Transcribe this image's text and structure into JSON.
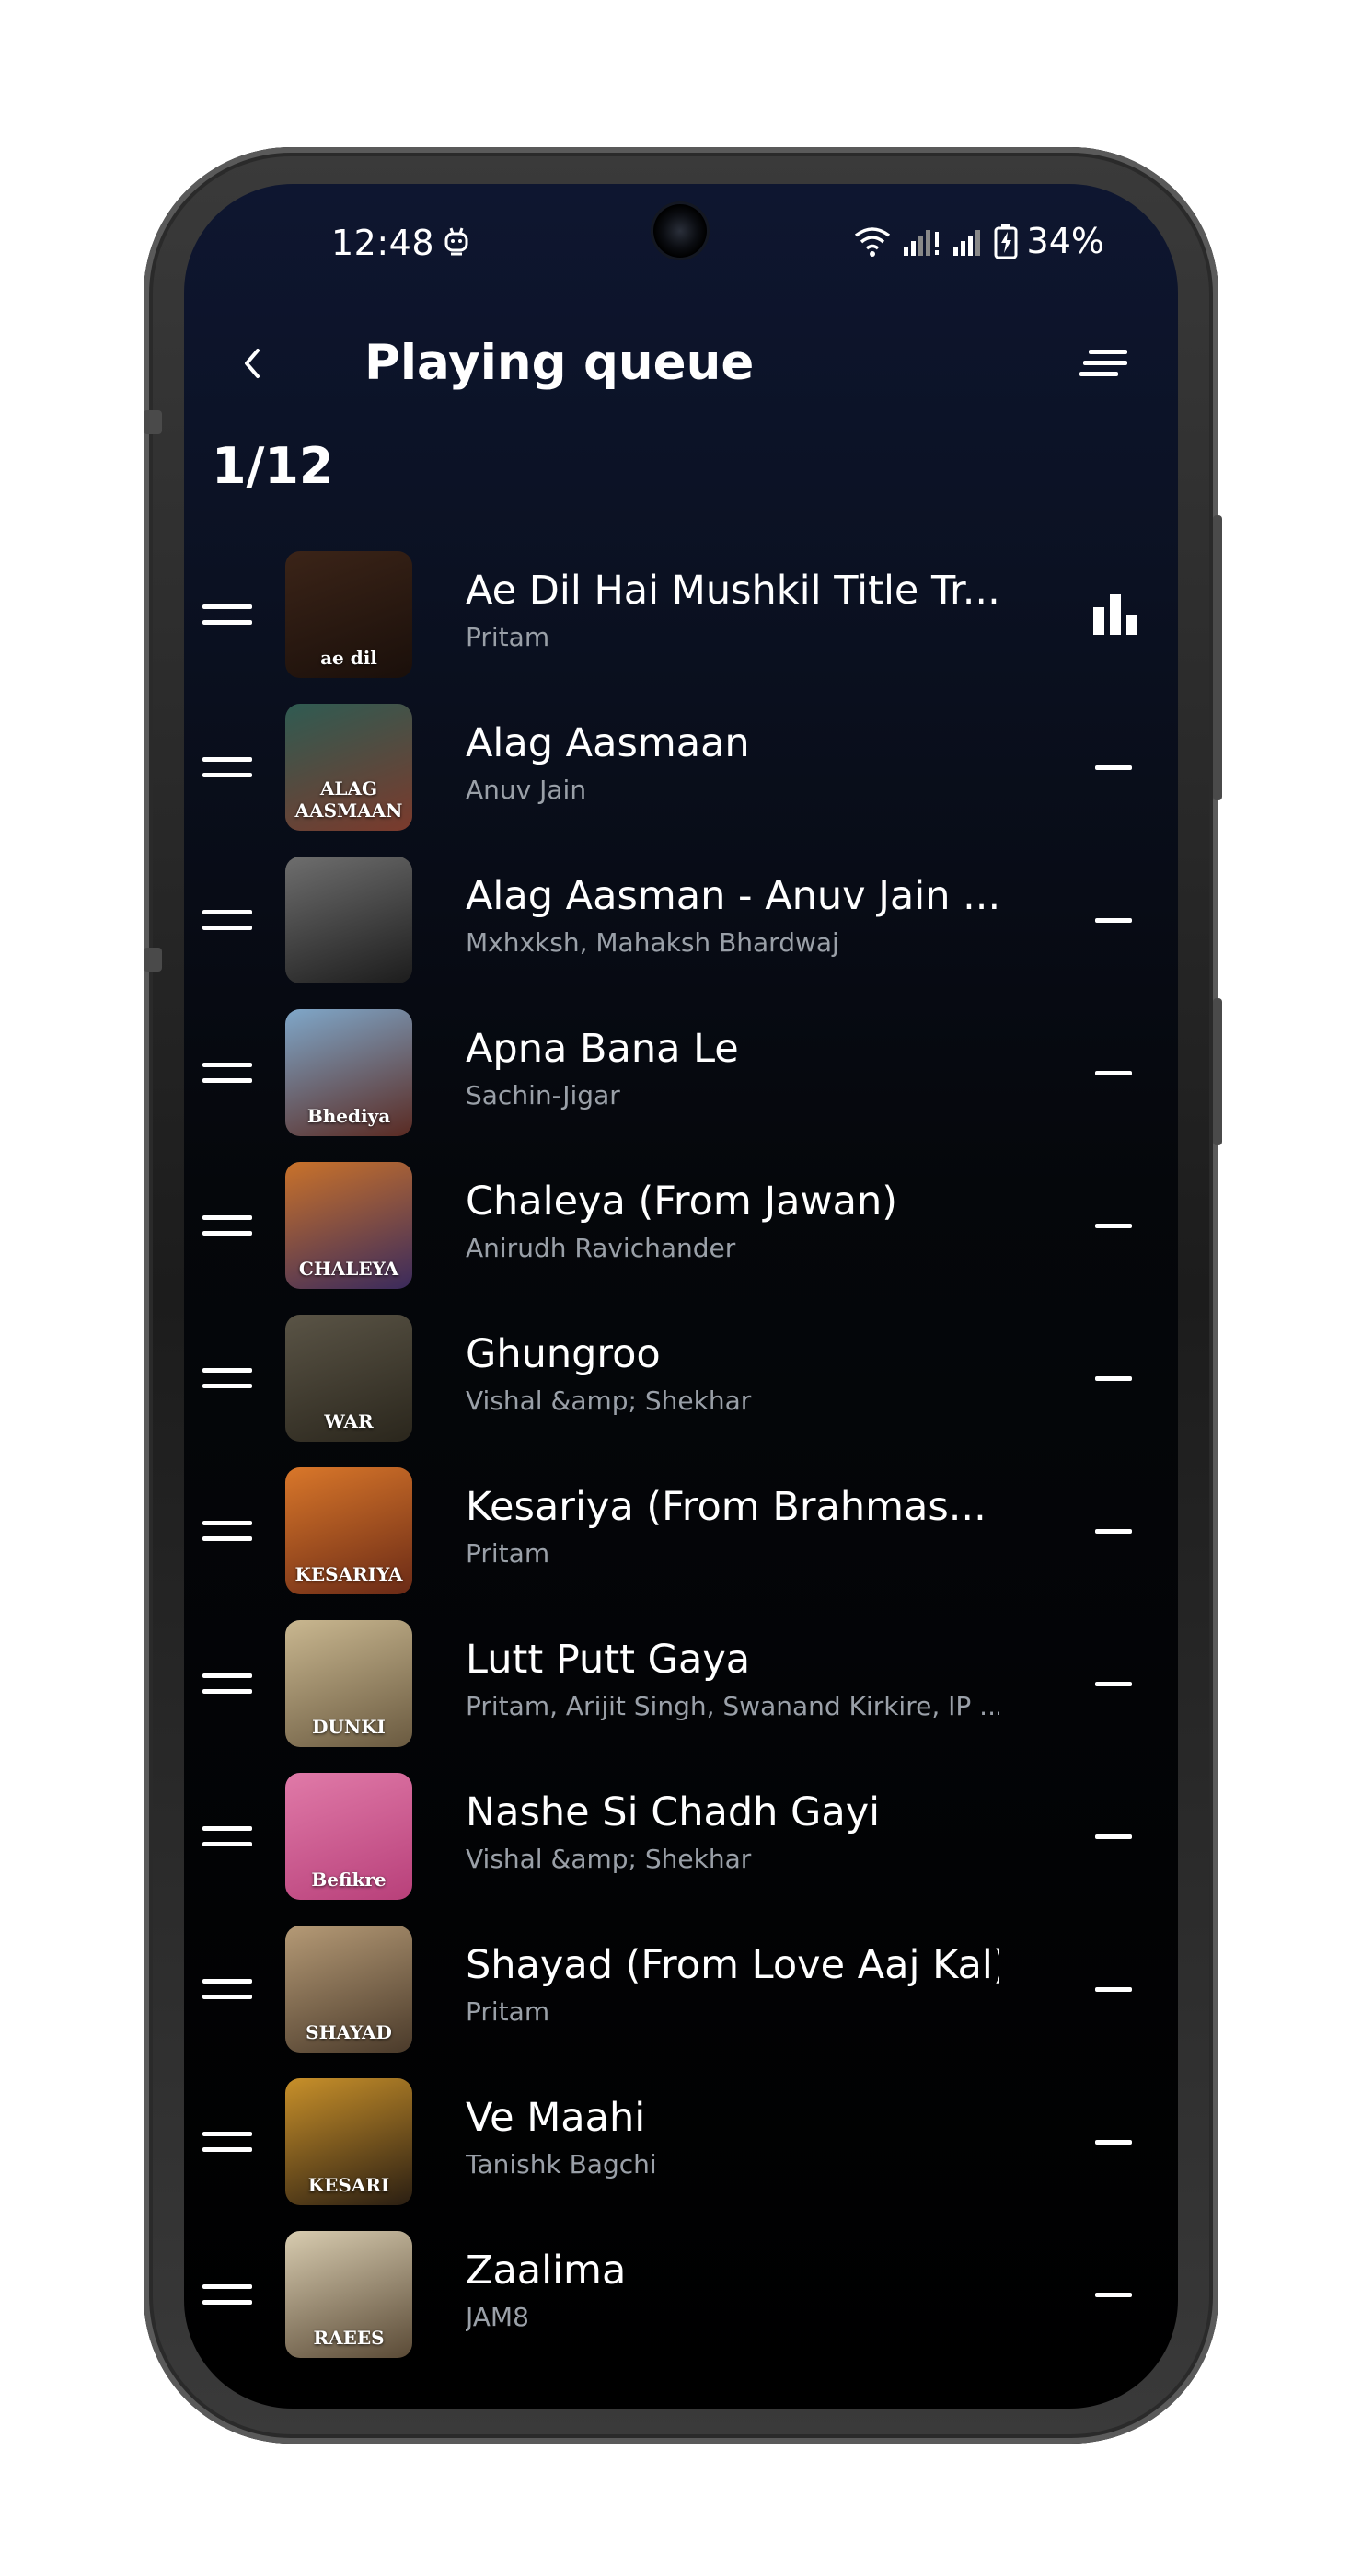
{
  "status": {
    "time": "12:48",
    "battery": "34%",
    "app_icon": "android-robot-icon",
    "icons": [
      "wifi-icon",
      "signal-icon",
      "signal-icon",
      "battery-charging-icon"
    ]
  },
  "header": {
    "back_icon": "chevron-left-icon",
    "title": "Playing queue",
    "sort_icon": "sort-lines-icon"
  },
  "queue": {
    "position": "1/12",
    "items": [
      {
        "title": "Ae Dil Hai Mushkil Title Tr...",
        "artist": "Pritam",
        "playing": true,
        "cover_text": "ae dil",
        "cover_colors": [
          "#3b2418",
          "#1a0f0a"
        ]
      },
      {
        "title": "Alag Aasmaan",
        "artist": "Anuv Jain",
        "playing": false,
        "cover_text": "ALAG AASMAAN",
        "cover_colors": [
          "#2f5b52",
          "#7b3a2c"
        ]
      },
      {
        "title": "Alag Aasman - Anuv Jain ...",
        "artist": "Mxhxksh, Mahaksh Bhardwaj",
        "playing": false,
        "cover_text": "",
        "cover_colors": [
          "#6e6e6e",
          "#1c1c1c"
        ]
      },
      {
        "title": "Apna Bana Le",
        "artist": "Sachin-Jigar",
        "playing": false,
        "cover_text": "Bhediya",
        "cover_colors": [
          "#7fa7c9",
          "#5a2a22"
        ]
      },
      {
        "title": "Chaleya (From Jawan)",
        "artist": "Anirudh Ravichander",
        "playing": false,
        "cover_text": "CHALEYA",
        "cover_colors": [
          "#c9722a",
          "#3a2a5c"
        ]
      },
      {
        "title": "Ghungroo",
        "artist": "Vishal &amp; Shekhar",
        "playing": false,
        "cover_text": "WAR",
        "cover_colors": [
          "#5a5446",
          "#2a261c"
        ]
      },
      {
        "title": "Kesariya (From Brahmas...",
        "artist": "Pritam",
        "playing": false,
        "cover_text": "KESARIYA",
        "cover_colors": [
          "#d9772a",
          "#6a2a16"
        ]
      },
      {
        "title": "Lutt Putt Gaya",
        "artist": "Pritam, Arijit Singh, Swanand Kirkire, IP ...",
        "playing": false,
        "cover_text": "DUNKI",
        "cover_colors": [
          "#c9b790",
          "#6a5a40"
        ]
      },
      {
        "title": "Nashe Si Chadh Gayi",
        "artist": "Vishal &amp; Shekhar",
        "playing": false,
        "cover_text": "Befikre",
        "cover_colors": [
          "#e07aa8",
          "#b8407a"
        ]
      },
      {
        "title": "Shayad (From Love Aaj Kal)",
        "artist": "Pritam",
        "playing": false,
        "cover_text": "SHAYAD",
        "cover_colors": [
          "#b59a76",
          "#4a3a2a"
        ]
      },
      {
        "title": "Ve Maahi",
        "artist": "Tanishk Bagchi",
        "playing": false,
        "cover_text": "KESARI",
        "cover_colors": [
          "#c8902a",
          "#2a1e12"
        ]
      },
      {
        "title": "Zaalima",
        "artist": "JAM8",
        "playing": false,
        "cover_text": "RAEES",
        "cover_colors": [
          "#d8ccb0",
          "#5a4a36"
        ]
      }
    ]
  }
}
